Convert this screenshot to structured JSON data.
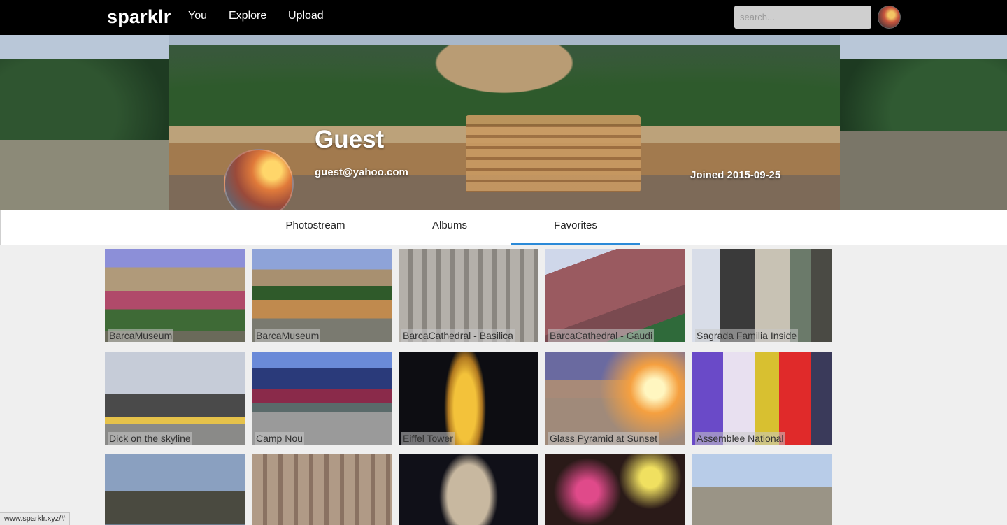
{
  "nav": {
    "logo": "sparklr",
    "links": [
      "You",
      "Explore",
      "Upload"
    ],
    "search_placeholder": "search..."
  },
  "profile": {
    "name": "Guest",
    "email": "guest@yahoo.com",
    "joined": "Joined 2015-09-25"
  },
  "tabs": [
    {
      "label": "Photostream",
      "active": false
    },
    {
      "label": "Albums",
      "active": false
    },
    {
      "label": "Favorites",
      "active": true
    }
  ],
  "photos": [
    {
      "caption": "BarcaMuseum"
    },
    {
      "caption": "BarcaMuseum"
    },
    {
      "caption": "BarcaCathedral - Basilica"
    },
    {
      "caption": "BarcaCathedral - Gaudi"
    },
    {
      "caption": "Sagrada Familia Inside"
    },
    {
      "caption": "Dick on the skyline"
    },
    {
      "caption": "Camp Nou"
    },
    {
      "caption": "Eiffel Tower"
    },
    {
      "caption": "Glass Pyramid at Sunset"
    },
    {
      "caption": "Assemblee National"
    },
    {
      "caption": ""
    },
    {
      "caption": ""
    },
    {
      "caption": ""
    },
    {
      "caption": ""
    },
    {
      "caption": ""
    }
  ],
  "status_url": "www.sparklr.xyz/#"
}
